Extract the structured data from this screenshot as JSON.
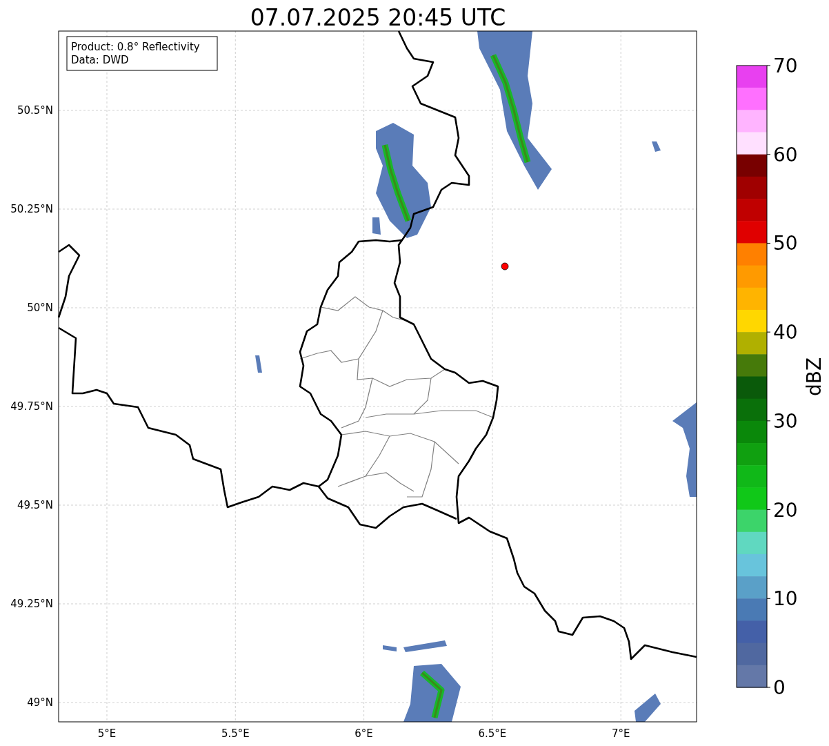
{
  "title": "07.07.2025 20:45 UTC",
  "legend": {
    "lines": [
      "Product: 0.8° Reflectivity",
      "Data: DWD"
    ]
  },
  "map": {
    "lat_ticks": [
      "50.5°N",
      "50.25°N",
      "50°N",
      "49.75°N",
      "49.5°N",
      "49.25°N",
      "49°N"
    ],
    "lon_ticks": [
      "5°E",
      "5.5°E",
      "6°E",
      "6.5°E",
      "7°E"
    ]
  },
  "colorbar": {
    "label": "dBZ",
    "ticks": [
      "70",
      "60",
      "50",
      "40",
      "30",
      "20",
      "10",
      "0"
    ],
    "bins": [
      {
        "color": "#e840f0"
      },
      {
        "color": "#ff70ff"
      },
      {
        "color": "#ffb4ff"
      },
      {
        "color": "#ffe0ff"
      },
      {
        "color": "#780000"
      },
      {
        "color": "#a00000"
      },
      {
        "color": "#c00000"
      },
      {
        "color": "#e00000"
      },
      {
        "color": "#ff8000"
      },
      {
        "color": "#ff9a00"
      },
      {
        "color": "#ffb400"
      },
      {
        "color": "#ffd700"
      },
      {
        "color": "#b0b000"
      },
      {
        "color": "#467a0a"
      },
      {
        "color": "#0a5a0a"
      },
      {
        "color": "#0a700a"
      },
      {
        "color": "#0a880a"
      },
      {
        "color": "#10a010"
      },
      {
        "color": "#10b818"
      },
      {
        "color": "#10c818"
      },
      {
        "color": "#3cd46a"
      },
      {
        "color": "#60d8c0"
      },
      {
        "color": "#68c4dc"
      },
      {
        "color": "#5aa0c8"
      },
      {
        "color": "#4a7ab4"
      },
      {
        "color": "#4460a8"
      },
      {
        "color": "#5068a0"
      },
      {
        "color": "#6478a8"
      }
    ]
  }
}
